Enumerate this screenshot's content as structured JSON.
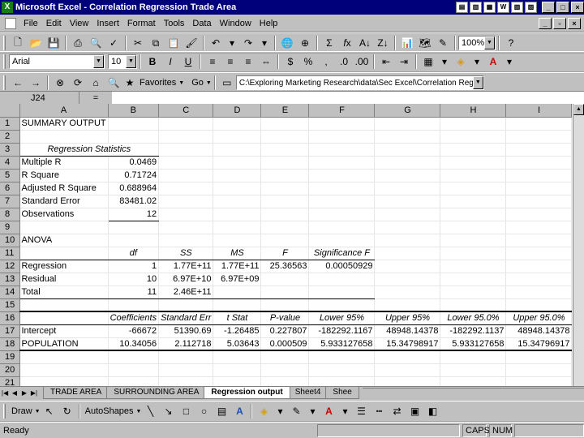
{
  "window": {
    "title": "Microsoft Excel - Correlation Regression Trade Area",
    "app_icon": "X"
  },
  "menu": [
    "File",
    "Edit",
    "View",
    "Insert",
    "Format",
    "Tools",
    "Data",
    "Window",
    "Help"
  ],
  "toolbar": {
    "zoom": "100%"
  },
  "format_bar": {
    "font": "Arial",
    "size": "10",
    "bold": "B",
    "italic": "I",
    "underline": "U",
    "currency": "$",
    "percent": "%",
    "comma": ","
  },
  "web_bar": {
    "favorites": "Favorites",
    "go": "Go",
    "address": "C:\\Exploring Marketing Research\\data\\Sec Excel\\Correlation Regre"
  },
  "formula_bar": {
    "name_box": "J24",
    "equals": "="
  },
  "columns": [
    "A",
    "B",
    "C",
    "D",
    "E",
    "F",
    "G",
    "H",
    "I"
  ],
  "rows": [
    {
      "n": "1",
      "c": [
        "SUMMARY OUTPUT",
        "",
        "",
        "",
        "",
        "",
        "",
        "",
        ""
      ]
    },
    {
      "n": "2",
      "c": [
        "",
        "",
        "",
        "",
        "",
        "",
        "",
        "",
        ""
      ]
    },
    {
      "n": "3",
      "c": [
        "Regression Statistics",
        "",
        "",
        "",
        "",
        "",
        "",
        "",
        ""
      ]
    },
    {
      "n": "4",
      "c": [
        "Multiple R",
        "0.0469",
        "",
        "",
        "",
        "",
        "",
        "",
        ""
      ]
    },
    {
      "n": "5",
      "c": [
        "R Square",
        "0.71724",
        "",
        "",
        "",
        "",
        "",
        "",
        ""
      ]
    },
    {
      "n": "6",
      "c": [
        "Adjusted R Square",
        "0.688964",
        "",
        "",
        "",
        "",
        "",
        "",
        ""
      ]
    },
    {
      "n": "7",
      "c": [
        "Standard Error",
        "83481.02",
        "",
        "",
        "",
        "",
        "",
        "",
        ""
      ]
    },
    {
      "n": "8",
      "c": [
        "Observations",
        "12",
        "",
        "",
        "",
        "",
        "",
        "",
        ""
      ]
    },
    {
      "n": "9",
      "c": [
        "",
        "",
        "",
        "",
        "",
        "",
        "",
        "",
        ""
      ]
    },
    {
      "n": "10",
      "c": [
        "ANOVA",
        "",
        "",
        "",
        "",
        "",
        "",
        "",
        ""
      ]
    },
    {
      "n": "11",
      "c": [
        "",
        "df",
        "SS",
        "MS",
        "F",
        "Significance F",
        "",
        "",
        ""
      ]
    },
    {
      "n": "12",
      "c": [
        "Regression",
        "1",
        "1.77E+11",
        "1.77E+11",
        "25.36563",
        "0.00050929",
        "",
        "",
        ""
      ]
    },
    {
      "n": "13",
      "c": [
        "Residual",
        "10",
        "6.97E+10",
        "6.97E+09",
        "",
        "",
        "",
        "",
        ""
      ]
    },
    {
      "n": "14",
      "c": [
        "Total",
        "11",
        "2.46E+11",
        "",
        "",
        "",
        "",
        "",
        ""
      ]
    },
    {
      "n": "15",
      "c": [
        "",
        "",
        "",
        "",
        "",
        "",
        "",
        "",
        ""
      ]
    },
    {
      "n": "16",
      "c": [
        "",
        "Coefficients",
        "Standard Err",
        "t Stat",
        "P-value",
        "Lower 95%",
        "Upper 95%",
        "Lower 95.0%",
        "Upper 95.0%"
      ]
    },
    {
      "n": "17",
      "c": [
        "Intercept",
        "-66672",
        "51390.69",
        "-1.26485",
        "0.227807",
        "-182292.1167",
        "48948.14378",
        "-182292.1137",
        "48948.14378"
      ]
    },
    {
      "n": "18",
      "c": [
        "POPULATION",
        "10.34056",
        "2.112718",
        "5.03643",
        "0.000509",
        "5.933127658",
        "15.34798917",
        "5.933127658",
        "15.34796917"
      ]
    },
    {
      "n": "19",
      "c": [
        "",
        "",
        "",
        "",
        "",
        "",
        "",
        "",
        ""
      ]
    },
    {
      "n": "20",
      "c": [
        "",
        "",
        "",
        "",
        "",
        "",
        "",
        "",
        ""
      ]
    },
    {
      "n": "21",
      "c": [
        "",
        "",
        "",
        "",
        "",
        "",
        "",
        "",
        ""
      ]
    }
  ],
  "sheet_tabs": [
    "TRADE AREA",
    "SURROUNDING AREA",
    "Regression output",
    "Sheet4",
    "Shee"
  ],
  "active_tab": "Regression output",
  "draw_bar": {
    "draw": "Draw",
    "autoshapes": "AutoShapes"
  },
  "status": {
    "mode": "Ready",
    "caps": "CAPS",
    "num": "NUM"
  }
}
